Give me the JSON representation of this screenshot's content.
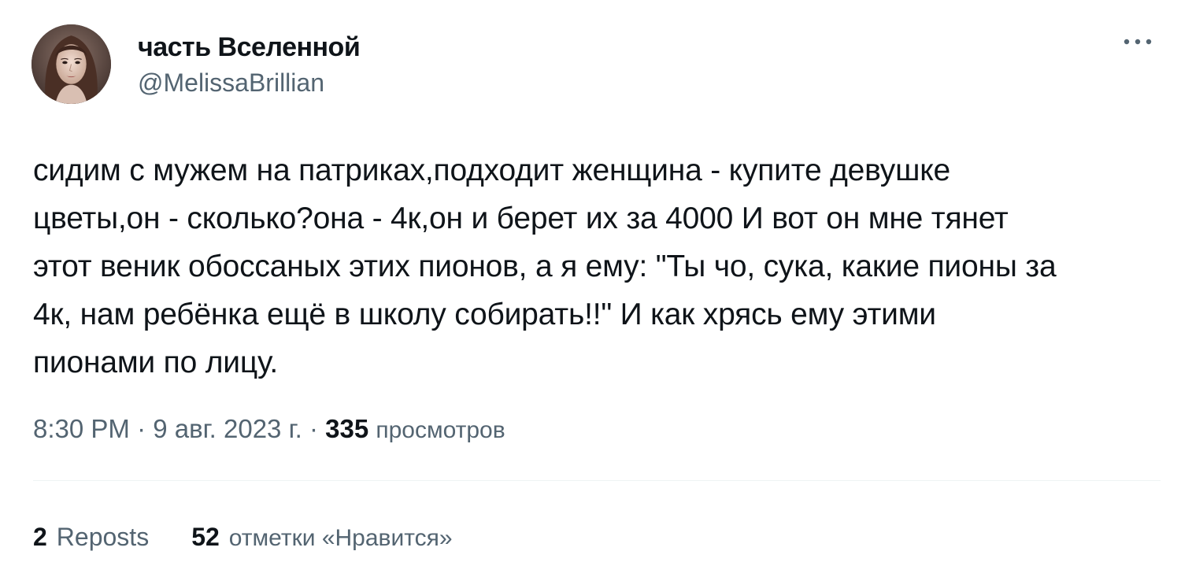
{
  "author": {
    "display_name": "часть Вселенной",
    "handle": "@MelissaBrillian"
  },
  "icons": {
    "more": "more-horizontal-icon",
    "avatar": "profile-photo"
  },
  "tweet": {
    "text_lines": [
      "сидим с мужем на патриках,подходит женщина - купите девушке",
      "цветы,он - сколько?она - 4к,он и  берет их за 4000 И вот он мне тянет",
      "этот веник обоссаных этих пионов, а я ему: \"Ты чо, сука, какие пионы за",
      "4к, нам ребёнка ещё в школу собирать!!\" И как хрясь ему этими",
      "пионами по лицу."
    ]
  },
  "meta": {
    "time": "8:30 PM",
    "separator": "·",
    "date": "9 авг. 2023 г.",
    "views_count": "335",
    "views_label": "просмотров"
  },
  "stats": {
    "reposts_count": "2",
    "reposts_label": "Reposts",
    "likes_count": "52",
    "likes_label": "отметки «Нравится»"
  },
  "colors": {
    "primary_text": "#0f1419",
    "secondary_text": "#536471",
    "divider": "#eff3f4",
    "background": "#ffffff"
  }
}
